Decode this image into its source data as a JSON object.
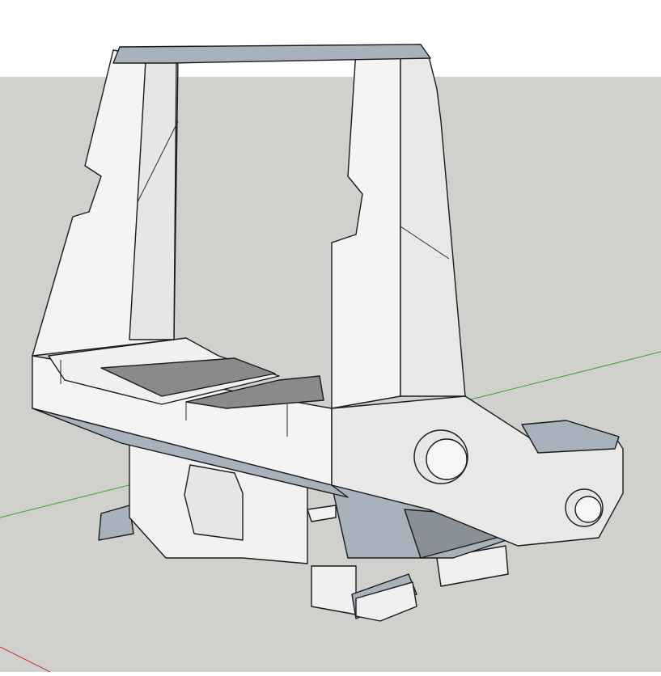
{
  "viewport": {
    "sky_color": "#ffffff",
    "ground_color": "#d0d0cc",
    "axis_green": "#33aa33",
    "axis_red": "#cc3333",
    "face_light": "#f2f2f2",
    "face_shade": "#e0e0e0",
    "face_dark": "#8a8a8a",
    "face_blue": "#a8b2bc"
  }
}
